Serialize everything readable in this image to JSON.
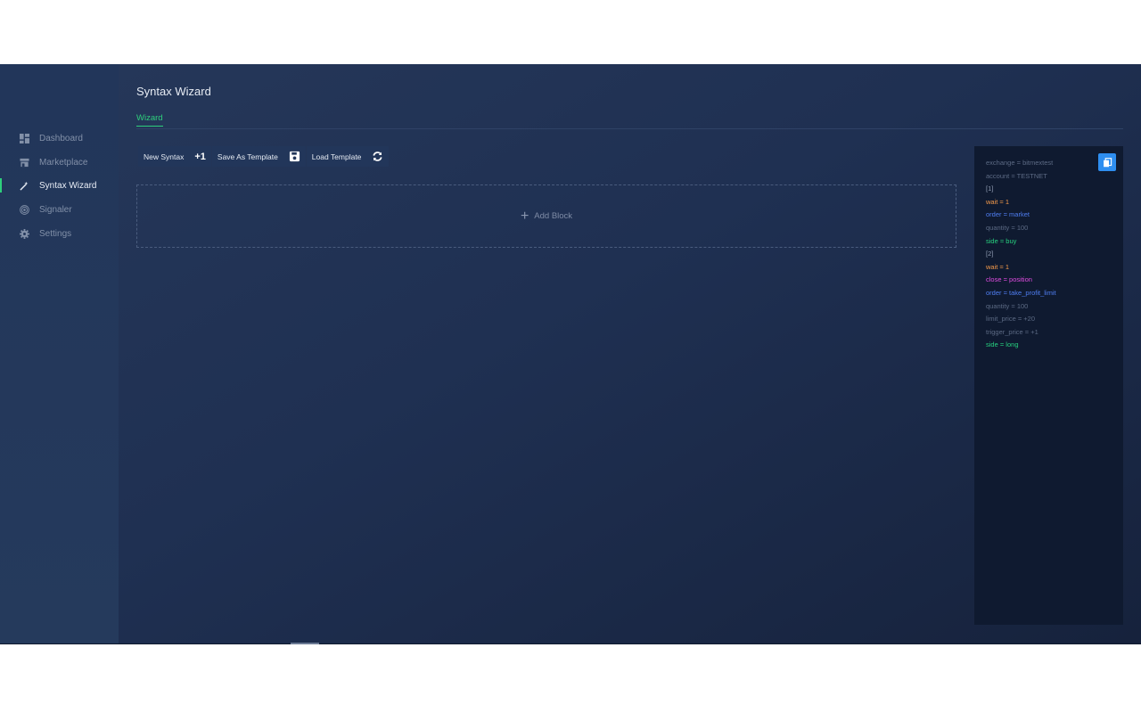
{
  "sidebar": {
    "items": [
      {
        "label": "Dashboard",
        "icon": "dashboard-icon",
        "active": false
      },
      {
        "label": "Marketplace",
        "icon": "store-icon",
        "active": false
      },
      {
        "label": "Syntax Wizard",
        "icon": "wand-icon",
        "active": true
      },
      {
        "label": "Signaler",
        "icon": "broadcast-icon",
        "active": false
      },
      {
        "label": "Settings",
        "icon": "gear-icon",
        "active": false
      }
    ]
  },
  "page": {
    "title": "Syntax Wizard",
    "tab": "Wizard"
  },
  "toolbar": {
    "new_syntax_label": "New Syntax",
    "new_syntax_icon": "+1",
    "save_template_label": "Save As Template",
    "load_template_label": "Load Template"
  },
  "add_block": {
    "label": "Add Block"
  },
  "code": {
    "lines": [
      {
        "text": "exchange = bitmextest",
        "color": "gray"
      },
      {
        "text": "account = TESTNET",
        "color": "gray"
      },
      {
        "text": "[1]",
        "color": "light"
      },
      {
        "text": "wait = 1",
        "color": "orange"
      },
      {
        "text": "order = market",
        "color": "blue"
      },
      {
        "text": "quantity = 100",
        "color": "gray"
      },
      {
        "text": "side = buy",
        "color": "green"
      },
      {
        "text": "[2]",
        "color": "light"
      },
      {
        "text": "wait = 1",
        "color": "orange"
      },
      {
        "text": "close = position",
        "color": "magenta"
      },
      {
        "text": "order = take_profit_limit",
        "color": "blue"
      },
      {
        "text": "quantity = 100",
        "color": "gray"
      },
      {
        "text": "limit_price = +20",
        "color": "gray"
      },
      {
        "text": "trigger_price = +1",
        "color": "gray"
      },
      {
        "text": "side = long",
        "color": "green"
      }
    ]
  },
  "colors": {
    "accent_green": "#2ecf7c",
    "copy_button_blue": "#2e8ef0",
    "background": "#1f3052"
  }
}
